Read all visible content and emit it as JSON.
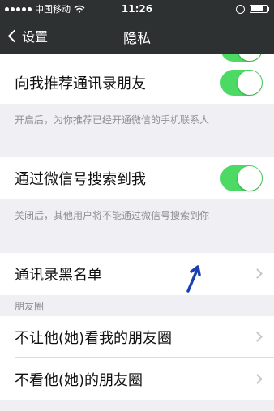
{
  "status_bar": {
    "carrier": "中国移动",
    "time": "11:26",
    "signal_bars": 5,
    "battery_level": 0.85
  },
  "nav": {
    "back_label": "设置",
    "title": "隐私"
  },
  "settings": {
    "recommend_contacts": {
      "label": "向我推荐通讯录朋友",
      "enabled": true,
      "note": "开启后，为你推荐已经开通微信的手机联系人"
    },
    "search_by_wechat_id": {
      "label": "通过微信号搜索到我",
      "enabled": true,
      "note": "关闭后，其他用户将不能通过微信号搜索到你"
    },
    "blacklist": {
      "label": "通讯录黑名单"
    },
    "moments_section": {
      "header": "朋友圈",
      "items": [
        {
          "label": "不让他(她)看我的朋友圈"
        },
        {
          "label": "不看他(她)的朋友圈"
        }
      ]
    }
  },
  "colors": {
    "bar_bg": "#2e3132",
    "toggle_on": "#4cd964",
    "page_bg": "#efeff4",
    "annotation_arrow": "#1a3fb5"
  }
}
